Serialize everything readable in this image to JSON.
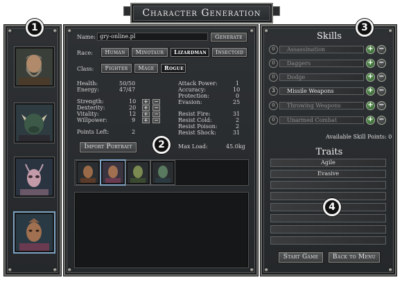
{
  "title": "Character Generation",
  "badges": [
    "1",
    "2",
    "3",
    "4"
  ],
  "name": {
    "label": "Name:",
    "value": "gry-online.pl",
    "generate_label": "Generate"
  },
  "race": {
    "label": "Race:",
    "options": [
      "Human",
      "Minotaur",
      "Lizardman",
      "Insectoid"
    ],
    "selected": "Lizardman"
  },
  "class": {
    "label": "Class:",
    "options": [
      "Fighter",
      "Mage",
      "Rogue"
    ],
    "selected": "Rogue"
  },
  "stats_left": {
    "health": {
      "label": "Health:",
      "value": "50/50"
    },
    "energy": {
      "label": "Energy:",
      "value": "47/47"
    },
    "strength": {
      "label": "Strength:",
      "value": "10"
    },
    "dexterity": {
      "label": "Dexterity:",
      "value": "20"
    },
    "vitality": {
      "label": "Vitality:",
      "value": "12"
    },
    "willpower": {
      "label": "Willpower:",
      "value": "9"
    },
    "points_left": {
      "label": "Points Left:",
      "value": "2"
    }
  },
  "stats_right": {
    "attack_power": {
      "label": "Attack Power:",
      "value": "1"
    },
    "accuracy": {
      "label": "Accuracy:",
      "value": "10"
    },
    "protection": {
      "label": "Protection:",
      "value": "0"
    },
    "evasion": {
      "label": "Evasion:",
      "value": "25"
    },
    "resist_fire": {
      "label": "Resist Fire:",
      "value": "31"
    },
    "resist_cold": {
      "label": "Resist Cold:",
      "value": "2"
    },
    "resist_poison": {
      "label": "Resist Poison:",
      "value": "2"
    },
    "resist_shock": {
      "label": "Resist Shock:",
      "value": "31"
    },
    "max_load": {
      "label": "Max Load:",
      "value": "45.0kg"
    }
  },
  "plus": "+",
  "minus": "−",
  "import_portrait_label": "Import Portrait",
  "skills": {
    "title": "Skills",
    "items": [
      {
        "level": "0",
        "name": "Assassination",
        "active": false
      },
      {
        "level": "0",
        "name": "Daggers",
        "active": false
      },
      {
        "level": "0",
        "name": "Dodge",
        "active": false
      },
      {
        "level": "3",
        "name": "Missile Weapons",
        "active": true
      },
      {
        "level": "0",
        "name": "Throwing Weapons",
        "active": false
      },
      {
        "level": "0",
        "name": "Unarmed Combat",
        "active": false
      }
    ],
    "available_points": "Available Skill Points: 0"
  },
  "traits": {
    "title": "Traits",
    "items": [
      "Agile",
      "Evasive",
      "",
      "",
      "",
      "",
      "",
      "",
      "",
      ""
    ]
  },
  "start_game_label": "Start Game",
  "back_to_menu_label": "Back to Menu",
  "colors": {
    "frame": "#6e6f6c",
    "panel": "#2b2e30",
    "plus_button": "#4f8a48"
  }
}
